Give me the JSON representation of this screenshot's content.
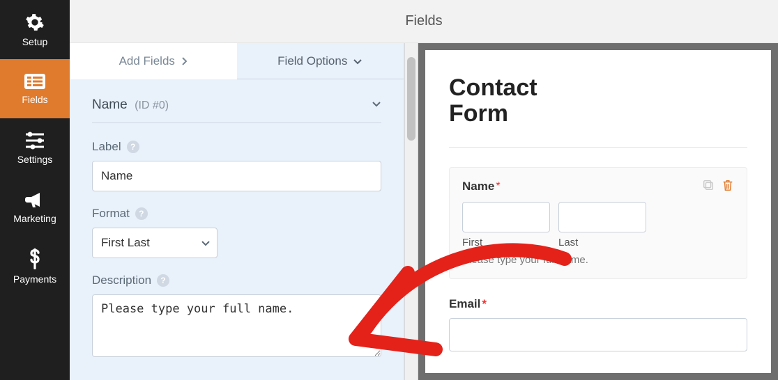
{
  "sidebar": {
    "items": [
      {
        "label": "Setup"
      },
      {
        "label": "Fields"
      },
      {
        "label": "Settings"
      },
      {
        "label": "Marketing"
      },
      {
        "label": "Payments"
      }
    ]
  },
  "topbar": {
    "title": "Fields"
  },
  "tabs": {
    "add": "Add Fields",
    "options": "Field Options"
  },
  "section": {
    "name": "Name",
    "id_label": "(ID #0)"
  },
  "form": {
    "label_caption": "Label",
    "label_value": "Name",
    "format_caption": "Format",
    "format_value": "First Last",
    "description_caption": "Description",
    "description_value": "Please type your full name."
  },
  "preview": {
    "title_line1": "Contact",
    "title_line2": "Form",
    "name_field": {
      "label": "Name",
      "required": "*",
      "sub_first": "First",
      "sub_last": "Last",
      "description": "Please type your full name."
    },
    "email_field": {
      "label": "Email",
      "required": "*"
    }
  }
}
